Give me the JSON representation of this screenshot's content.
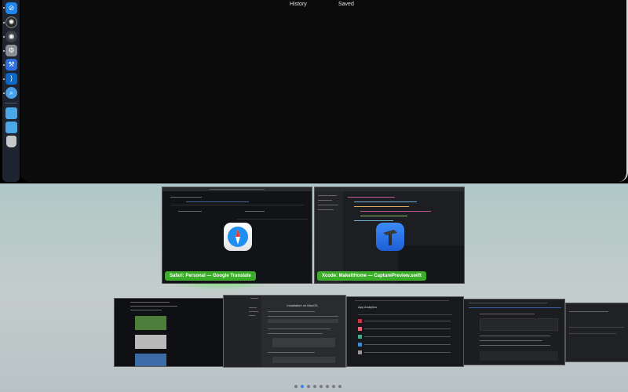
{
  "top_window": {
    "tabs": [
      "History",
      "Saved"
    ]
  },
  "dock": {
    "items": [
      "safari-icon",
      "chatgpt-icon",
      "chrome-icon",
      "settings-icon",
      "xcode-icon",
      "vscode-icon",
      "finder-search-icon",
      "folder-icon",
      "folder-icon",
      "trash-icon"
    ]
  },
  "windows": [
    {
      "label": "Safari: Personal — Google Translate",
      "app": "safari-icon"
    },
    {
      "label": "Xcode: MakeItHome — CapturePreview.swift",
      "app": "xcode-icon"
    }
  ],
  "bottom_row": {
    "doc_title": "Installation on MacOS",
    "analytics_title": "App Analytics"
  },
  "pager": {
    "count": 8,
    "active": 1
  },
  "colors": {
    "accent_green": "#3cad2a",
    "page_active": "#3c7df0"
  }
}
